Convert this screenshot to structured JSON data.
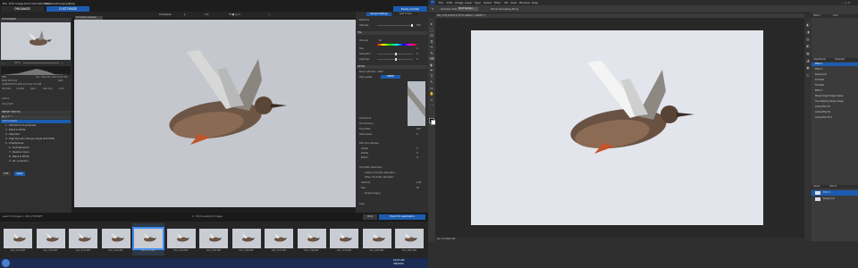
{
  "dxo": {
    "menu": [
      "File",
      "Edit",
      "Image",
      "DxO OpticsModules",
      "Palettes",
      "Workspace",
      "Help"
    ],
    "tabs": {
      "organize": "ORGANIZE",
      "customize": "CUSTOMIZE"
    },
    "top_right": "Easily publish",
    "toolbar": {
      "compare": "Compare",
      "zoom": "1:1",
      "right_btn": "Correction preview"
    },
    "histogram_label": "HISTOGRAM",
    "zoom_field": "41 %",
    "exif": {
      "row1_left": "PRP",
      "row1_right": "Sun, Mar 08, 2015 6:05 AM",
      "row2_left": "RAW DFX-CW",
      "row2_right": "LRO",
      "lens": "CANON EF70-200 mm f/4L IS USM",
      "iso": "ISO 800",
      "shutter": "1/1250",
      "aperture": "f/4.0",
      "focal": "200 mm",
      "ev": "0 EV",
      "auth": "Author",
      "copy": "Copyright"
    },
    "preset_editor": "PRESET EDITOR",
    "presets": [
      "DxO presets",
      "1 - Portrait and Landscape",
      "2 - Black & White",
      "3 - Standard",
      "4 - High Dynamic Range (single shot HDR)",
      "5 - Smartphone",
      "6 - DxO Standard",
      "7 - Neutral colors",
      "8 - Black & White",
      "9 - No correction"
    ],
    "left_buttons": {
      "edit": "Edit",
      "apply": "Apply"
    },
    "right_tabs": [
      "Sample Settings",
      "Split Screen"
    ],
    "right_labels": {
      "exposure": "Exposure",
      "intensity": "Intensity",
      "hsl": "HSL",
      "channel": "Channel",
      "channel_val": "All",
      "hue": "Hue",
      "saturation": "Saturation",
      "lightness": "Lightness",
      "detail": "DETAIL",
      "noise": "Noise reduction - RAW",
      "prime": "PRIME",
      "quality": "High quality",
      "luminance": "Luminance",
      "chrominance": "Chrominance",
      "fine_detail": "Fine detail",
      "dead_pixels": "Dead pixels",
      "lens_sharpness": "DxO lens softness",
      "global": "Global",
      "details": "Details",
      "bokeh": "Bokeh",
      "ca": "Chromatic aberration",
      "lateral": "Lateral chromatic aberration",
      "other_ca": "Other chromatic aberration",
      "intensity2": "Intensity",
      "size": "Size",
      "purple": "Purple fringing",
      "crop": "Crop"
    },
    "right_values": [
      "100",
      "0",
      "0",
      "0",
      "100",
      "40",
      "100",
      "0",
      "0",
      "0",
      "0",
      "0.00",
      "50"
    ],
    "filmstrip_path": "search 8 images > DSC_2793.NEF",
    "filmstrip_count": "1 / 18 (8 selected) images",
    "print_label": "Print",
    "export_label": "Export to application",
    "thumbs": [
      "DSC_2791.NEF",
      "DSC_2791.NEF",
      "DSC_2791.NEF",
      "DSC_2792.NEF",
      "DSC_2793.NEF",
      "DSC_2794.NEF",
      "DSC_2795.NEF",
      "DSC_2796.NEF",
      "DSC_2797.NEF",
      "DSC_2798.NEF",
      "DSC_2799.NEF",
      "DSC_2800.NEF",
      "DSC_2801.NEF"
    ],
    "selected_thumb": 4,
    "clock": "10:07 AM",
    "date": "3/8/2015"
  },
  "ps": {
    "menu": [
      "PS",
      "File",
      "Edit",
      "Image",
      "Layer",
      "Type",
      "Select",
      "Filter",
      "3D",
      "View",
      "Window",
      "Help"
    ],
    "options": {
      "sample": "Sample Size",
      "point": "Point Sample",
      "show": "Show Sampling Ring"
    },
    "doc_tab": "DSC_2793_DxO.tif @ 33.3% (Reflect 1, RGB/8*) ×",
    "status": "Doc: 57.1M/57.1M",
    "panels": {
      "history": "History",
      "color": "Color",
      "adjust": "Adjustments",
      "properties": "Properties",
      "layers": "Layers",
      "actions": "Actions"
    },
    "history_items": [
      "Effect 1",
      "Effect 2",
      "Background",
      "Fill Width",
      "Fill Width",
      "Effect 3",
      "Merge (Single Image) Sweep",
      "Tone Mapping (Single Image)",
      "Analog Efex Pro",
      "Analog Efex Pro",
      "Analog Efex Pro 2"
    ],
    "layer_items": [
      "Effect 1",
      "Background"
    ],
    "colors": {
      "accent": "#1c5cb0"
    }
  }
}
